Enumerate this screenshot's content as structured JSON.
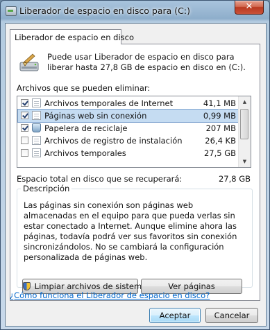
{
  "window": {
    "title": "Liberador de espacio en disco para  (C:)",
    "close_glyph": "✕"
  },
  "tab": {
    "label": "Liberador de espacio en disco"
  },
  "intro": {
    "text": "Puede usar Liberador de espacio en disco para liberar hasta 27,8 GB de espacio en disco en  (C:)."
  },
  "list": {
    "label": "Archivos que se pueden eliminar:",
    "items": [
      {
        "name": "Archivos temporales de Internet",
        "size": "41,1 MB",
        "checked": true,
        "icon": "folder-lock-icon"
      },
      {
        "name": "Páginas web sin conexión",
        "size": "0,99 MB",
        "checked": true,
        "icon": "offline-pages-icon",
        "selected": true
      },
      {
        "name": "Papelera de reciclaje",
        "size": "207 MB",
        "checked": true,
        "icon": "recycle-bin-icon"
      },
      {
        "name": "Archivos de registro de instalación",
        "size": "26,4 KB",
        "checked": false,
        "icon": "file-icon"
      },
      {
        "name": "Archivos temporales",
        "size": "27,5 GB",
        "checked": false,
        "icon": "file-icon"
      }
    ]
  },
  "total": {
    "label": "Espacio total en disco que se recuperará:",
    "value": "27,8 GB"
  },
  "description": {
    "title": "Descripción",
    "text": "Las páginas sin conexión son páginas web almacenadas en el equipo para que pueda verlas sin estar conectado a Internet. Aunque elimine ahora las páginas, todavía podrá ver sus favoritos sin conexión sincronizándolos. No se cambiará la configuración personalizada de páginas web."
  },
  "buttons": {
    "clean_system": "Limpiar archivos de sistema",
    "view_pages": "Ver páginas",
    "ok": "Aceptar",
    "cancel": "Cancelar"
  },
  "help_link": "¿Cómo funciona el Liberador de espacio en disco?",
  "colors": {
    "accent": "#0066cc",
    "selection": "#c5dcf2",
    "close": "#c9523a"
  }
}
